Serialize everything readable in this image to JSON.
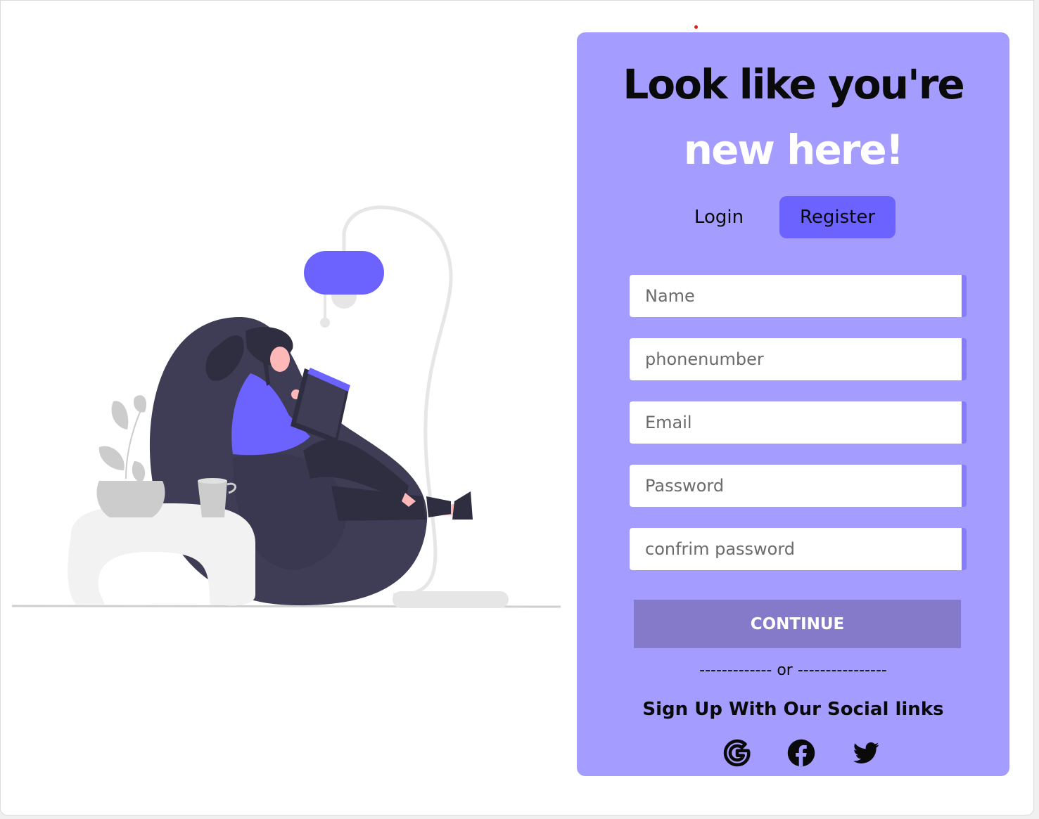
{
  "hero": {
    "line1": "Look like you're",
    "line2": "new here!"
  },
  "tabs": {
    "login": "Login",
    "register": "Register",
    "active": "Register"
  },
  "form": {
    "name_placeholder": "Name",
    "phone_placeholder": "phonenumber",
    "email_placeholder": "Email",
    "password_placeholder": "Password",
    "confirm_placeholder": "confrim password",
    "submit_label": "CONTINUE"
  },
  "divider": "------------- or ----------------",
  "social": {
    "title": "Sign Up With Our Social links",
    "icons": [
      "google-icon",
      "facebook-icon",
      "twitter-icon"
    ]
  },
  "colors": {
    "card": "#a49cff",
    "accent": "#6c63ff",
    "button": "#857ac9",
    "chair": "#3f3d56"
  }
}
